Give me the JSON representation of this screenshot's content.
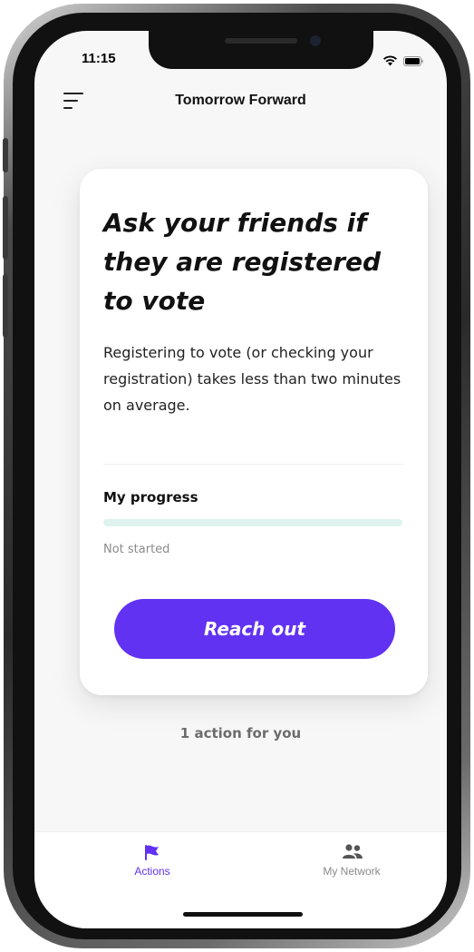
{
  "status_bar": {
    "time": "11:15"
  },
  "header": {
    "title": "Tomorrow Forward"
  },
  "card": {
    "title": "Ask your friends if they are registered to vote",
    "description": "Registering to vote (or checking your registration) takes less than two minutes on average.",
    "progress": {
      "label": "My progress",
      "status": "Not started",
      "value": 0
    },
    "cta_label": "Reach out"
  },
  "actions_count": "1 action for you",
  "tabbar": {
    "tabs": [
      {
        "label": "Actions",
        "icon": "flag-icon",
        "active": true
      },
      {
        "label": "My Network",
        "icon": "people-icon",
        "active": false
      }
    ]
  },
  "colors": {
    "accent": "#6132f2",
    "progress_track": "#dff3ee",
    "background": "#f7f7f7",
    "inactive_tab": "#8a8a8a"
  }
}
